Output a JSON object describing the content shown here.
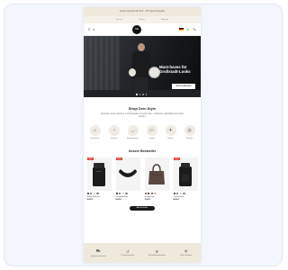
{
  "promo_bar": {
    "text": "Gratis Versand ab 50 € · 30 Tage Rückgabe"
  },
  "utility_links": [
    "Service",
    "Filialen",
    "Magazin"
  ],
  "nav": {
    "logo_text": "UG"
  },
  "hero": {
    "headline": "Must-haves für Großstadt-Looks",
    "cta_label": "Jetzt entdecken",
    "slide_count": 4,
    "active_slide": 0
  },
  "styles_section": {
    "title": "Shop Dein Style",
    "subtitle": "Entdecke unsere Taschen und Rucksäcke für jeden Tag – funktional, nachhaltig und zeitlos designt."
  },
  "categories": [
    {
      "label": "Rucksäcke",
      "icon": "backpack-icon",
      "glyph": "⌂"
    },
    {
      "label": "Taschen",
      "icon": "bag-icon",
      "glyph": "◔"
    },
    {
      "label": "Bauchtaschen",
      "icon": "waist-bag-icon",
      "glyph": "◡"
    },
    {
      "label": "Laptop",
      "icon": "laptop-icon",
      "glyph": "▭"
    },
    {
      "label": "Reisen",
      "icon": "travel-icon",
      "glyph": "✈"
    },
    {
      "label": "Zubehör",
      "icon": "accessory-icon",
      "glyph": "◎"
    }
  ],
  "bestsellers": {
    "title": "Unsere Bestseller",
    "more_label": "Alle Bestseller",
    "products": [
      {
        "badge": "-20%",
        "name": "Rolltop Rucksack",
        "price": "99,95 €",
        "swatches": [
          "#222222",
          "#6b6b6b",
          "#c9c3b6",
          "#8b7d6b"
        ]
      },
      {
        "badge": "-15%",
        "name": "Crossbody Bag",
        "price": "69,95 €",
        "swatches": [
          "#222222",
          "#6b6b6b",
          "#c9c3b6",
          "#8b7d6b"
        ]
      },
      {
        "badge": "",
        "name": "Shopper Tote",
        "price": "79,95 €",
        "swatches": [
          "#5a4840",
          "#222222",
          "#8c3a36",
          "#c9c3b6"
        ]
      },
      {
        "badge": "-10%",
        "name": "City Rucksack",
        "price": "89,95 €",
        "swatches": [
          "#222222",
          "#6b6b6b",
          "#c9c3b6",
          "#8b7d6b"
        ]
      }
    ]
  },
  "usps": [
    {
      "icon": "truck-icon",
      "glyph": "⛟",
      "text": "Kostenloser Versand"
    },
    {
      "icon": "return-icon",
      "glyph": "↺",
      "text": "30 Tage Rückgabe"
    },
    {
      "icon": "leaf-icon",
      "glyph": "❦",
      "text": "Nachhaltige Materialien"
    },
    {
      "icon": "shield-icon",
      "glyph": "⛨",
      "text": "Sicher bezahlen"
    }
  ],
  "colors": {
    "accent_sale": "#e2453c",
    "beige_bar": "#efe9dc",
    "card_background": "#f3f6fd"
  }
}
